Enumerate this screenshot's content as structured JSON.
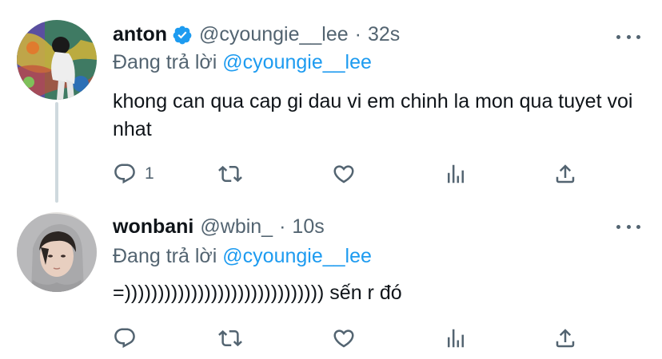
{
  "tweets": [
    {
      "display_name": "anton",
      "verified": true,
      "handle": "@cyoungie__lee",
      "separator": "·",
      "time": "32s",
      "reply_prefix": "Đang trả lời",
      "reply_mention": "@cyoungie__lee",
      "text": "khong can qua cap gi dau vi em chinh la mon qua tuyet voi nhat",
      "reply_count": "1"
    },
    {
      "display_name": "wonbani",
      "verified": false,
      "handle": "@wbin_",
      "separator": "·",
      "time": "10s",
      "reply_prefix": "Đang trả lời",
      "reply_mention": "@cyoungie__lee",
      "text": "=)))))))))))))))))))))))))))))) sến r đó",
      "reply_count": ""
    }
  ],
  "icons": [
    "reply-icon",
    "retweet-icon",
    "like-icon",
    "analytics-icon",
    "share-icon",
    "more-icon",
    "verified-badge-icon"
  ],
  "colors": {
    "text": "#0f1419",
    "muted": "#536471",
    "link": "#1d9bf0",
    "thread_line": "#cfd9de"
  }
}
